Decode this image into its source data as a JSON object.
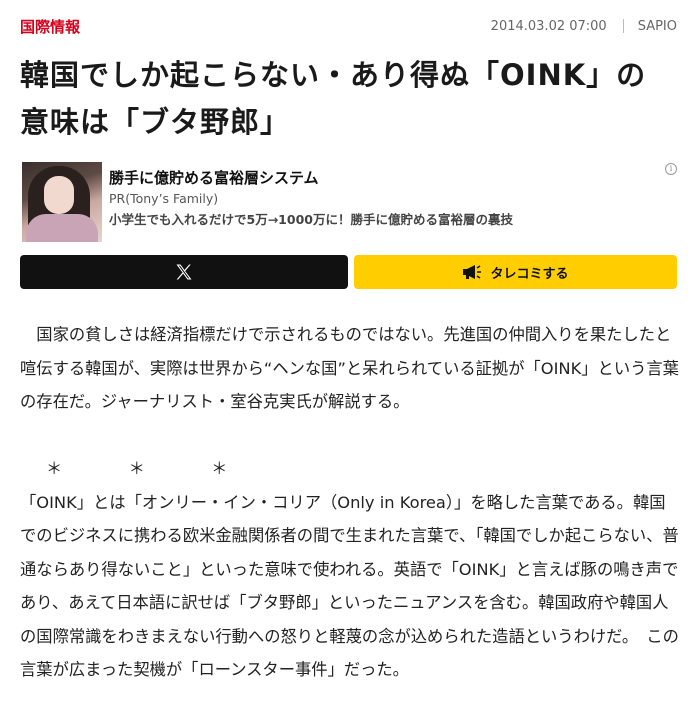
{
  "header": {
    "category": "国際情報",
    "date": "2014.03.02 07:00",
    "source": "SAPIO"
  },
  "article": {
    "title_lines": [
      "韓国でしか起こらない・あり得ぬ「OINK」の",
      "意味は「ブタ野郎」"
    ],
    "paragraphs": [
      "国家の貧しさは経済指標だけで示されるものではない。先進国の仲間入りを果たしたと喧伝する韓国が、実際は世界から“ヘンな国”と呆れられている証拠が「OINK」という言葉の存在だ。ジャーナリスト・室谷克実氏が解説する。",
      "＊　＊　＊",
      "「OINK」とは「オンリー・イン・コリア（Only in Korea）」を略した言葉である。韓国でのビジネスに携わる欧米金融関係者の間で生まれた言葉で、「韓国でしか起こらない、普通ならあり得ないこと」といった意味で使われる。英語で「OINK」と言えば豚の鳴き声であり、あえて日本語に訳せば「ブタ野郎」といったニュアンスを含む。韓国政府や韓国人の国際常識をわきまえない行動への怒りと軽蔑の念が込められた造語というわけだ。　この言葉が広まった契機が「ローンスター事件」だった。"
    ]
  },
  "ad": {
    "title": "勝手に億貯める富裕層システム",
    "sponsor": "PR(Tony’s Family)",
    "description": "小学生でも入れるだけで5万→1000万に！勝手に億貯める富裕層の裏技",
    "info_icon": "info-icon"
  },
  "share": {
    "x_icon": "x-logo-icon",
    "tarekomi_label": "タレコミする",
    "tarekomi_icon": "megaphone-icon"
  },
  "colors": {
    "category": "#d6001c",
    "x_button": "#111111",
    "tarekomi_button": "#ffcd00"
  }
}
